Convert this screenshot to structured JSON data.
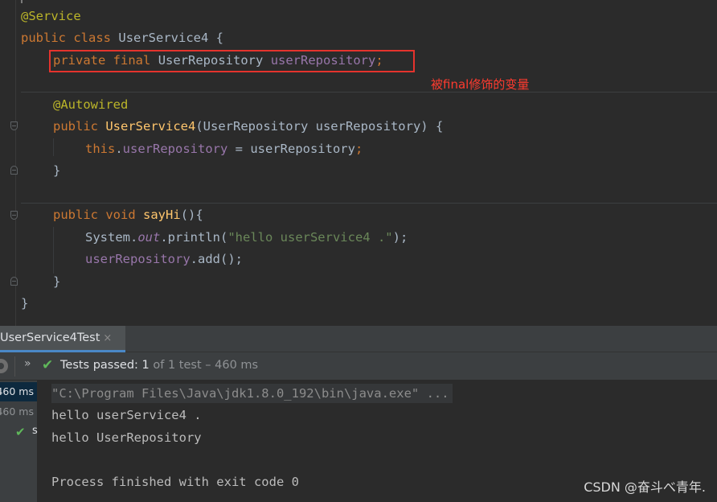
{
  "editor": {
    "lines": {
      "ann_service": "@Service",
      "class_kw1": "public",
      "class_kw2": "class",
      "class_name": "UserService4 {",
      "field_kw1": "private",
      "field_kw2": "final",
      "field_type": "UserRepository",
      "field_name": "userRepository",
      "semi": ";",
      "ann_autowired": "@Autowired",
      "ctor_kw": "public",
      "ctor_name": "UserService4",
      "ctor_params": "(UserRepository userRepository) {",
      "this_kw": "this",
      "dot": ".",
      "this_field": "userRepository",
      "assign": " = userRepository",
      "close1": "}",
      "method_kw1": "public",
      "method_kw2": "void",
      "method_name": "sayHi",
      "method_params": "(){",
      "sys": "System.",
      "out": "out",
      "println": ".println(",
      "str": "\"hello userService4 .\"",
      "println_end": ");",
      "repo_field": "userRepository",
      "add_call": ".add();",
      "close2": "}",
      "close3": "}"
    },
    "annotation_note": "被final修饰的变量"
  },
  "run_panel": {
    "tab_label": "UserService4Test",
    "tab_close": "×",
    "status_prefix": "Tests passed: ",
    "status_count": "1",
    "status_suffix": " of 1 test – 460 ms",
    "tree": [
      {
        "time": "460 ms"
      },
      {
        "time": "460 ms"
      }
    ],
    "tree_leaf_label": "s",
    "console": [
      "\"C:\\Program Files\\Java\\jdk1.8.0_192\\bin\\java.exe\" ...",
      "hello userService4 .",
      "hello UserRepository",
      "",
      "Process finished with exit code 0"
    ]
  },
  "watermark": "CSDN @奋斗べ青年.",
  "colors": {
    "keyword": "#cc7832",
    "annotation": "#bbb529",
    "field": "#9876aa",
    "method": "#ffc66d",
    "string": "#6a8759",
    "highlight_box": "#e5332d",
    "pass_green": "#5fb85a"
  }
}
